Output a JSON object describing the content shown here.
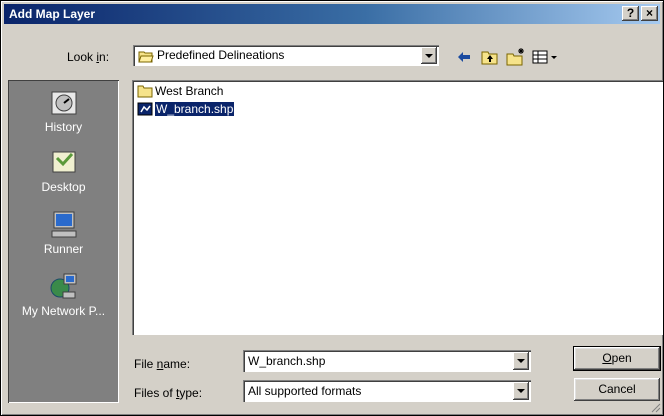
{
  "window": {
    "title": "Add Map Layer",
    "help_label": "?",
    "close_label": "×"
  },
  "lookin": {
    "label_pre": "Look ",
    "label_u": "i",
    "label_post": "n:",
    "value": "Predefined Delineations"
  },
  "toolbar": {
    "back_icon": "back-arrow-icon",
    "up_icon": "up-folder-icon",
    "new_icon": "new-folder-icon",
    "view_icon": "view-menu-icon"
  },
  "places": [
    {
      "label": "History",
      "icon": "history-icon"
    },
    {
      "label": "Desktop",
      "icon": "desktop-icon"
    },
    {
      "label": "Runner",
      "icon": "computer-icon"
    },
    {
      "label": "My Network P...",
      "icon": "network-icon"
    }
  ],
  "files": [
    {
      "name": "West Branch",
      "type": "folder",
      "selected": false
    },
    {
      "name": "W_branch.shp",
      "type": "file",
      "selected": true
    }
  ],
  "filename": {
    "label_pre": "File ",
    "label_u": "n",
    "label_post": "ame:",
    "value": "W_branch.shp"
  },
  "filetype": {
    "label_pre": "Files of ",
    "label_u": "t",
    "label_post": "ype:",
    "value": "All supported formats"
  },
  "buttons": {
    "open_u": "O",
    "open_rest": "pen",
    "cancel": "Cancel"
  }
}
